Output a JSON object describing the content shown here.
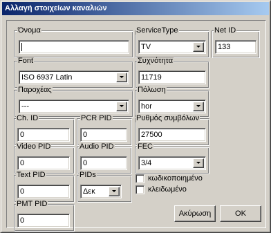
{
  "window": {
    "title": "Αλλαγή στοιχείων καναλιών"
  },
  "name": {
    "label": "Όνομα",
    "value": ""
  },
  "service_type": {
    "label": "ServiceType",
    "value": "TV"
  },
  "net_id": {
    "label": "Net ID",
    "value": "133"
  },
  "font": {
    "label": "Font",
    "value": "ISO 6937 Latin"
  },
  "frequency": {
    "label": "Συχνότητα",
    "value": "11719"
  },
  "providers": {
    "label": "Παροχέας",
    "value": "---"
  },
  "polarization": {
    "label": "Πόλωση",
    "value": "hor"
  },
  "ch_id": {
    "label": "Ch. ID",
    "value": "0"
  },
  "pcr_pid": {
    "label": "PCR PID",
    "value": "0"
  },
  "symbol_rate": {
    "label": "Ρυθμός συμβόλων",
    "value": "27500"
  },
  "video_pid": {
    "label": "Video PID",
    "value": "0"
  },
  "audio_pid": {
    "label": "Audio PID",
    "value": "0"
  },
  "fec": {
    "label": "FEC",
    "value": "3/4"
  },
  "text_pid": {
    "label": "Text PID",
    "value": "0"
  },
  "pids": {
    "label": "PIDs",
    "value": "Δεκ"
  },
  "encrypted": {
    "label": "κωδικοποιημένο",
    "checked": false
  },
  "locked": {
    "label": "κλειδωμένο",
    "checked": false
  },
  "pmt_pid": {
    "label": "PMT PID",
    "value": "0"
  },
  "buttons": {
    "cancel": "Ακύρωση",
    "ok": "OK"
  },
  "colors": {
    "title_start": "#0a246a",
    "title_end": "#a6caf0",
    "face": "#d4d0c8"
  }
}
